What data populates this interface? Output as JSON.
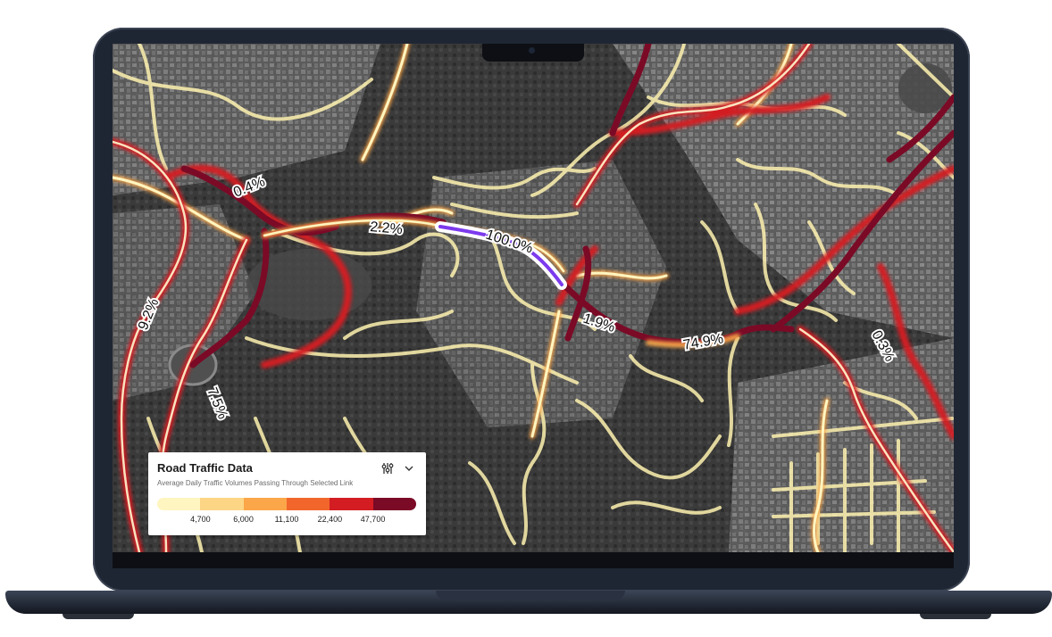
{
  "legend": {
    "title": "Road Traffic Data",
    "subtitle": "Average Daily Traffic Volumes Passing Through Selected Link",
    "filter_icon": "sliders-icon",
    "collapse_icon": "chevron-down-icon",
    "scale_colors": [
      "#fef5c0",
      "#fcd585",
      "#fba649",
      "#f2662c",
      "#d31d23",
      "#7b0a26"
    ],
    "ticks": [
      "4,700",
      "6,000",
      "11,100",
      "22,400",
      "47,700"
    ]
  },
  "map": {
    "labels": [
      "0.4%",
      "2.2%",
      "100.0%",
      "9.2%",
      "1.9%",
      "74.9%",
      "0.3%",
      "7.5%"
    ],
    "selected_link_color": "#7c3aed"
  }
}
